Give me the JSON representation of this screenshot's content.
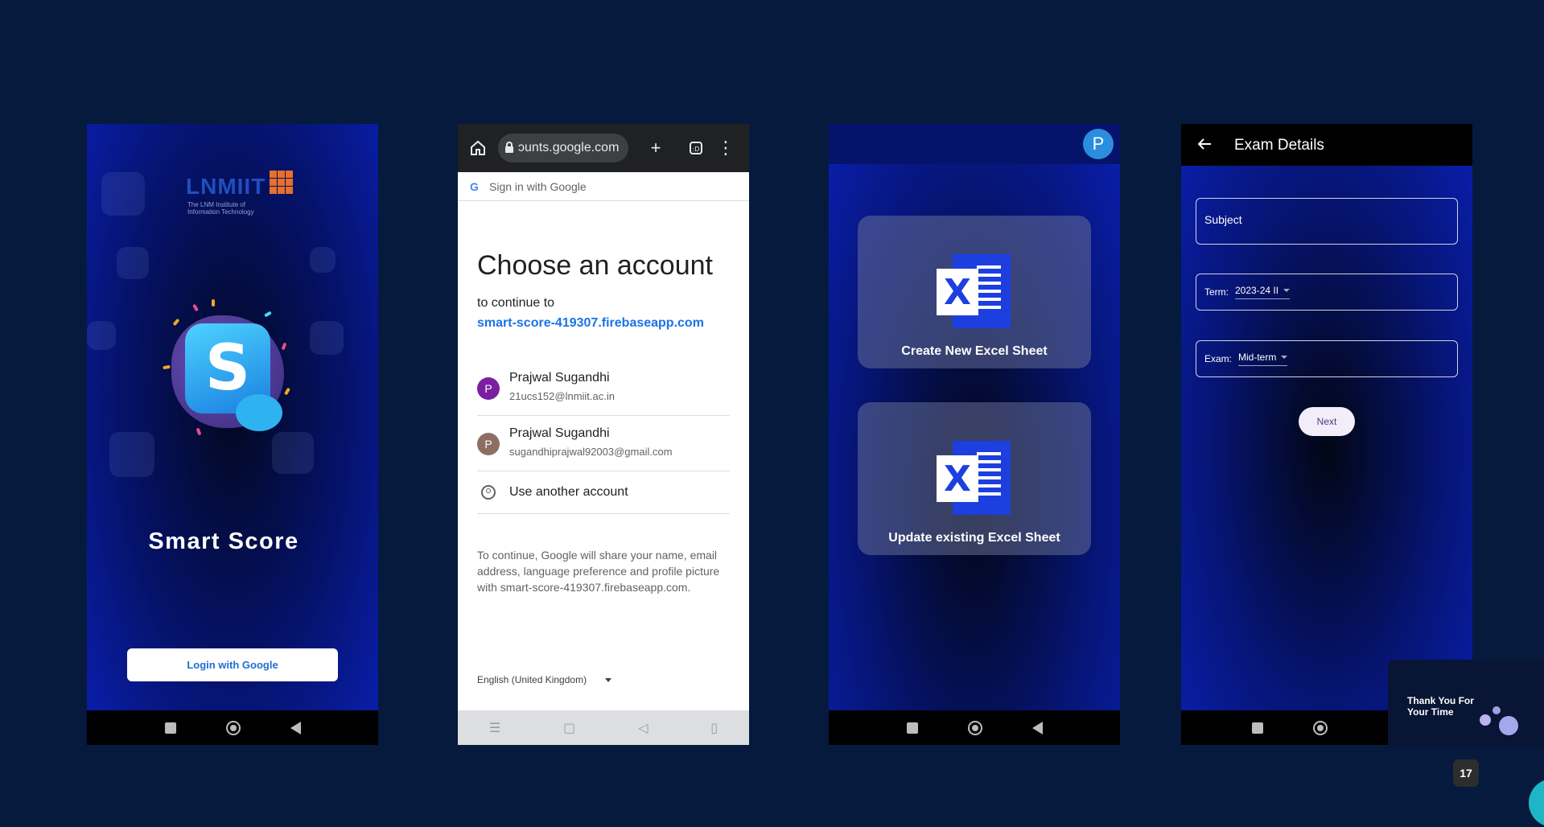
{
  "splash": {
    "logo_text": "LNMIIT",
    "logo_subtitle": "The LNM Institute of Information Technology",
    "app_title": "Smart Score",
    "login_button": "Login with Google"
  },
  "google": {
    "url": "ɔunts.google.com",
    "strip_logo": "G",
    "strip_text": "Sign in with Google",
    "title": "Choose an account",
    "continue_to": "to continue to",
    "app_url": "smart-score-419307.firebaseapp.com",
    "accounts": [
      {
        "initial": "P",
        "name": "Prajwal Sugandhi",
        "email": "21ucs152@lnmiit.ac.in",
        "color": "#7b1fa2"
      },
      {
        "initial": "P",
        "name": "Prajwal Sugandhi",
        "email": "sugandhiprajwal92003@gmail.com",
        "color": "#8d6e63"
      }
    ],
    "use_another": "Use another account",
    "disclaimer": "To continue, Google will share your name, email address, language preference and profile picture with smart-score-419307.firebaseapp.com.",
    "language": "English (United Kingdom)"
  },
  "home": {
    "profile_initial": "P",
    "cards": [
      {
        "label": "Create New Excel Sheet"
      },
      {
        "label": "Update existing Excel Sheet"
      }
    ]
  },
  "exam": {
    "title": "Exam Details",
    "subject_placeholder": "Subject",
    "term_label": "Term:",
    "term_value": "2023-24 II",
    "exam_label": "Exam:",
    "exam_value": "Mid-term",
    "next_button": "Next"
  },
  "overlay": {
    "thank_you": "Thank You For Your Time",
    "page_number": "17"
  },
  "colors": {
    "background": "#061a3e",
    "google_blue": "#1a73e8",
    "excel_blue": "#1d3fe0"
  }
}
